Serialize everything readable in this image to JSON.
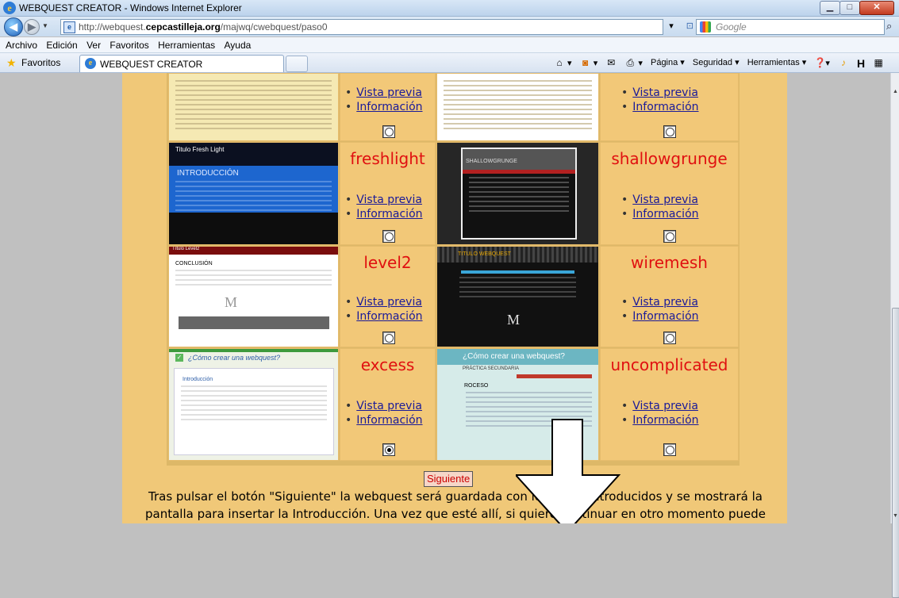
{
  "window": {
    "title": "WEBQUEST CREATOR - Windows Internet Explorer"
  },
  "address": {
    "url_prefix": "http://webquest.",
    "url_domain": "cepcastilleja.org",
    "url_path": "/majwq/cwebquest/paso0"
  },
  "search": {
    "placeholder": "Google"
  },
  "menu": [
    "Archivo",
    "Edición",
    "Ver",
    "Favoritos",
    "Herramientas",
    "Ayuda"
  ],
  "favorites": {
    "label": "Favoritos",
    "tab_label": "WEBQUEST CREATOR"
  },
  "commandbar": {
    "page": "Página",
    "security": "Seguridad",
    "tools": "Herramientas"
  },
  "themes": [
    {
      "name": "",
      "preview": "Vista previa",
      "info": "Información",
      "selected": false
    },
    {
      "name": "",
      "preview": "Vista previa",
      "info": "Información",
      "selected": false
    },
    {
      "name": "freshlight",
      "preview": "Vista previa",
      "info": "Información",
      "selected": false
    },
    {
      "name": "shallowgrunge",
      "preview": "Vista previa",
      "info": "Información",
      "selected": false
    },
    {
      "name": "level2",
      "preview": "Vista previa",
      "info": "Información",
      "selected": false
    },
    {
      "name": "wiremesh",
      "preview": "Vista previa",
      "info": "Información",
      "selected": false
    },
    {
      "name": "excess",
      "preview": "Vista previa",
      "info": "Información",
      "selected": true
    },
    {
      "name": "uncomplicated",
      "preview": "Vista previa",
      "info": "Información",
      "selected": false
    }
  ],
  "thumbs": {
    "freshlight_title": "Titulo Fresh Light",
    "freshlight_heading": "INTRODUCCIÓN",
    "shallow_title": "SHALLOWGRUNGE",
    "level2_title": "Título Level2",
    "level2_heading": "CONCLUSIÓN",
    "wiremesh_title": "TITULO WEBQUEST",
    "excess_title": "¿Cómo crear una webquest?",
    "excess_heading": "Introducción",
    "uncomplicated_title": "¿Cómo crear una webquest?",
    "uncomplicated_sub": "PRÁCTICA SECUNDARIA",
    "uncomplicated_heading": "ROCESO"
  },
  "footer": {
    "button": "Siguiente",
    "line1": "Tras pulsar el botón \"Siguiente\" la webquest será guardada con los datos introducidos y se mostrará la",
    "line2": "pantalla para insertar la Introducción. Una vez que esté allí, si quiere continuar en otro momento puede"
  }
}
